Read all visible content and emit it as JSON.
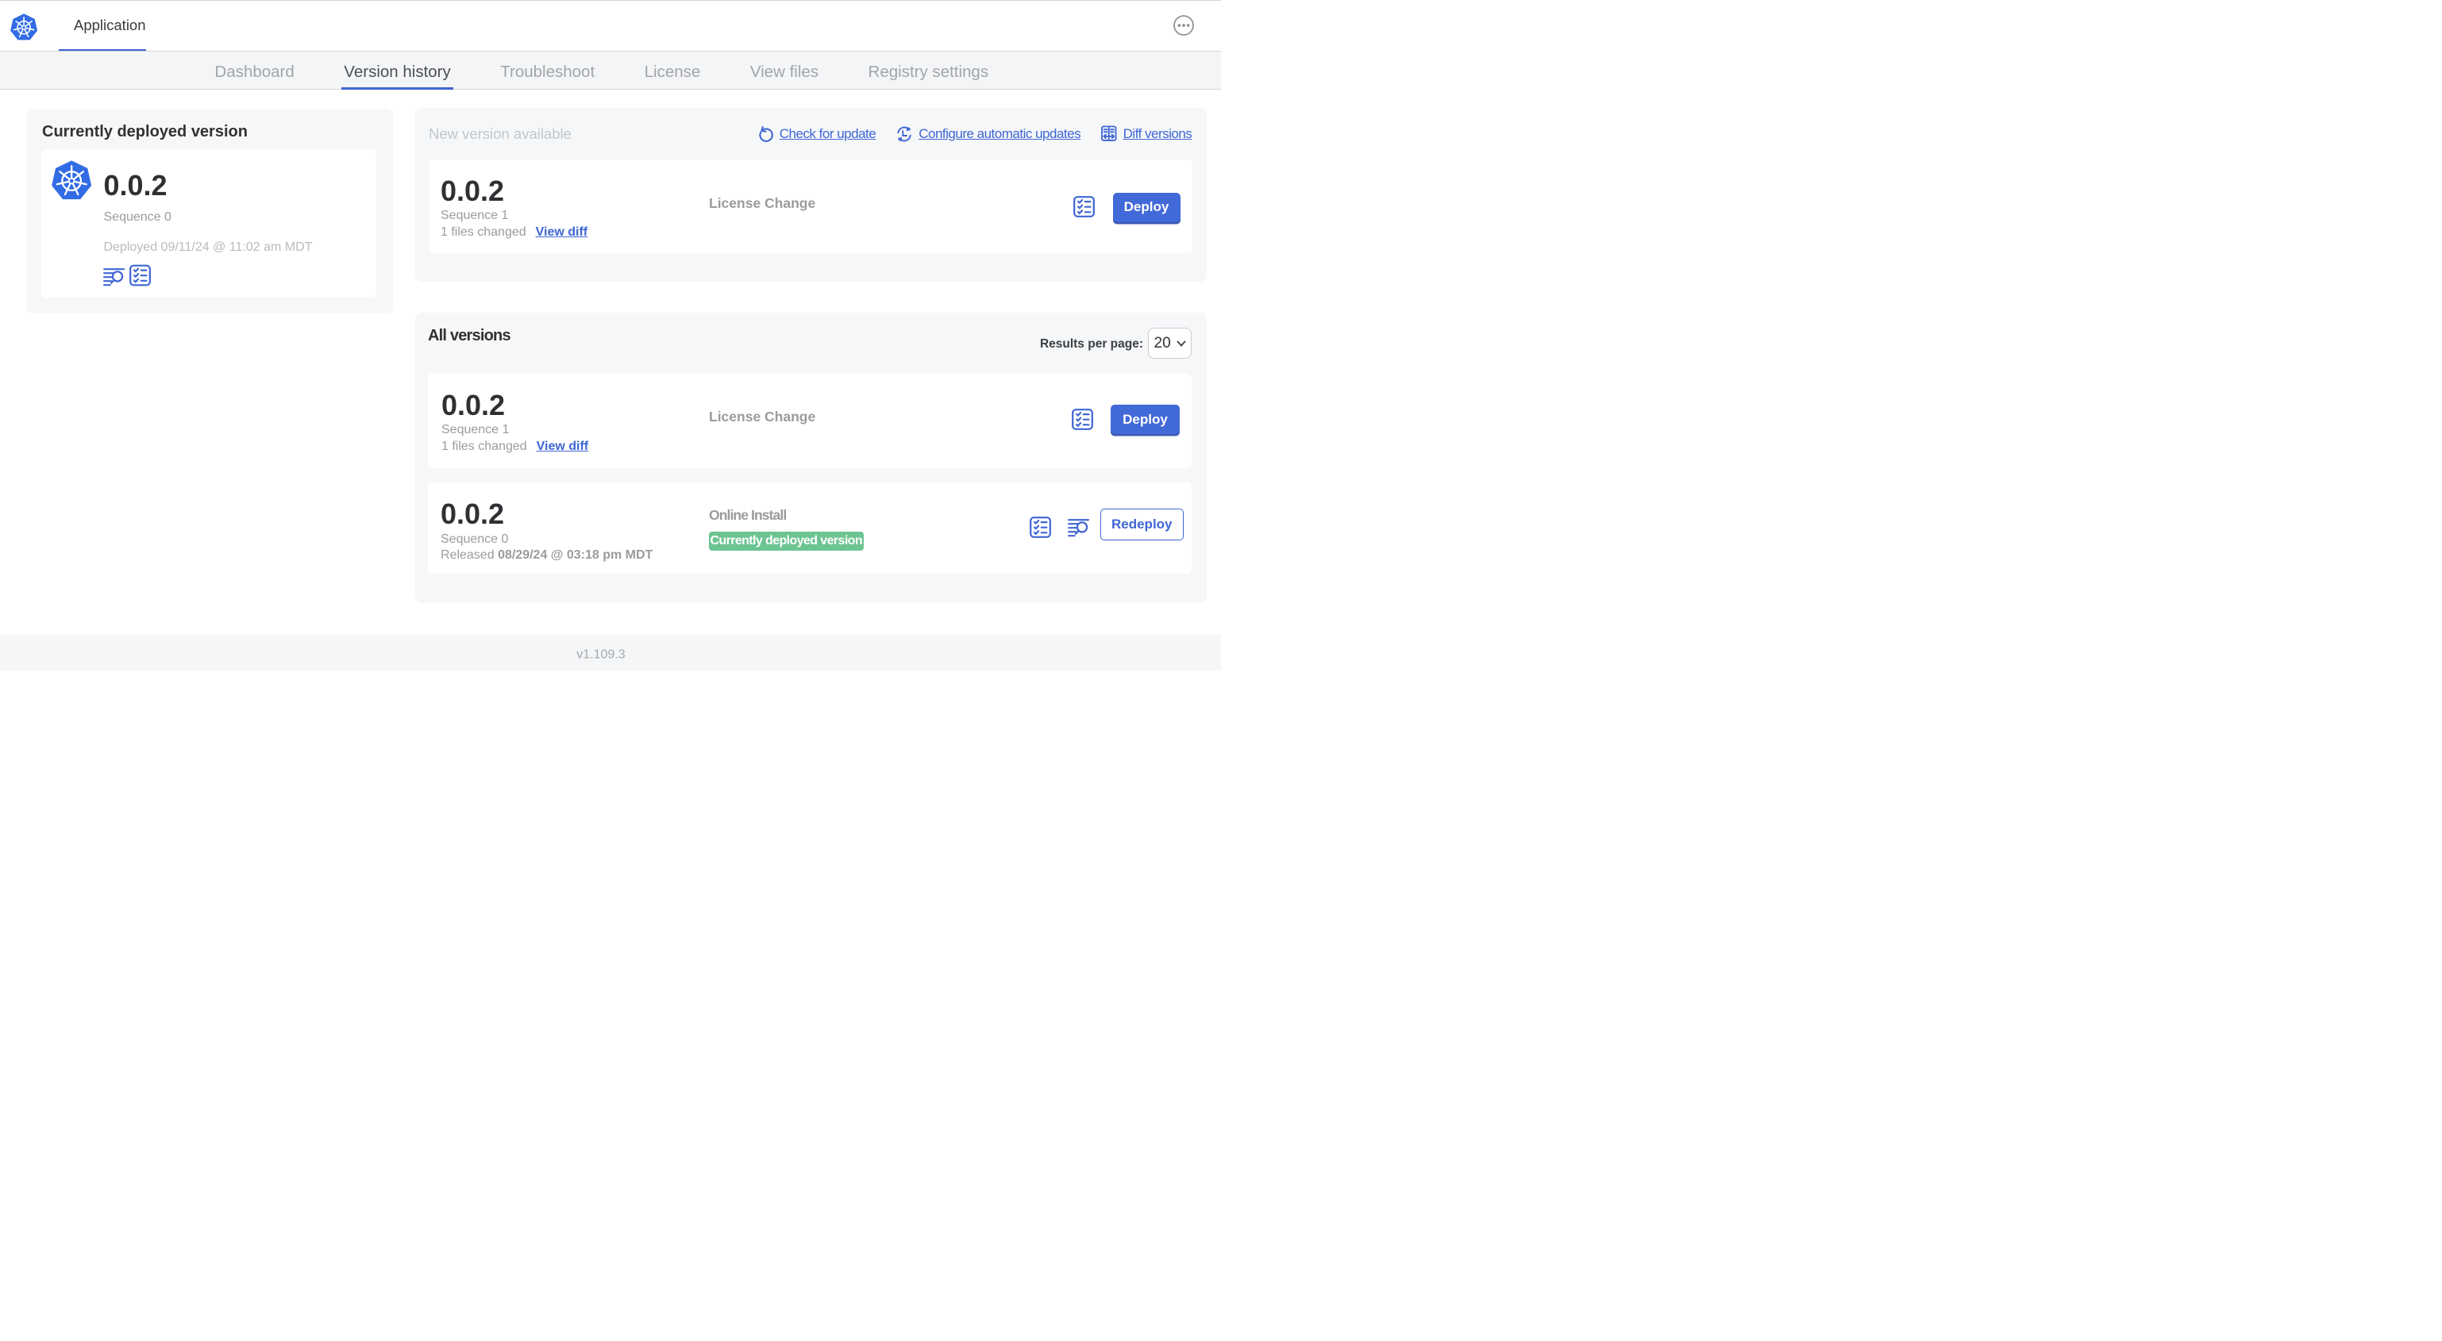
{
  "app": {
    "title": "Application"
  },
  "nav": {
    "tabs": [
      {
        "label": "Dashboard",
        "active": false
      },
      {
        "label": "Version history",
        "active": true
      },
      {
        "label": "Troubleshoot",
        "active": false
      },
      {
        "label": "License",
        "active": false
      },
      {
        "label": "View files",
        "active": false
      },
      {
        "label": "Registry settings",
        "active": false
      }
    ]
  },
  "left_panel": {
    "heading": "Currently deployed version",
    "version": "0.0.2",
    "sequence": "Sequence 0",
    "deployed": "Deployed 09/11/24 @ 11:02 am MDT"
  },
  "new_version": {
    "heading": "New version available",
    "check_link": "Check for update",
    "configure_link": "Configure automatic updates",
    "diff_link": "Diff versions",
    "card": {
      "version": "0.0.2",
      "sequence": "Sequence 1",
      "files_changed": "1 files changed",
      "view_diff": "View diff",
      "source": "License Change",
      "deploy_label": "Deploy"
    }
  },
  "all_versions": {
    "heading": "All versions",
    "results_label": "Results per page:",
    "page_size": "20",
    "rows": [
      {
        "version": "0.0.2",
        "sequence": "Sequence 1",
        "files_changed": "1 files changed",
        "view_diff": "View diff",
        "source": "License Change",
        "action": "Deploy"
      },
      {
        "version": "0.0.2",
        "sequence": "Sequence 0",
        "released_label": "Released",
        "released_date": "08/29/24 @ 03:18 pm MDT",
        "source": "Online Install",
        "badge": "Currently deployed version",
        "action": "Redeploy"
      }
    ]
  },
  "footer": {
    "version": "v1.109.3"
  },
  "colors": {
    "accent_blue": "#3e65d4",
    "button_blue": "#4269d8",
    "k8s_blue": "#326ce5",
    "badge_green": "#6cc492"
  }
}
